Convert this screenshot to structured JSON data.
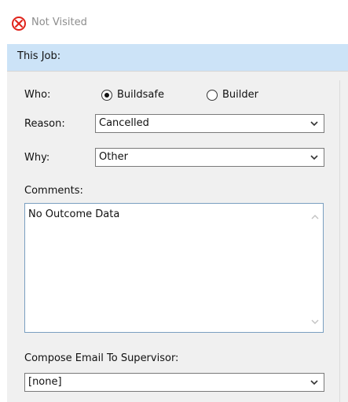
{
  "status": {
    "label": "Not Visited",
    "icon": "circle-x-icon",
    "icon_color": "#e0231a"
  },
  "section": {
    "title": "This Job:"
  },
  "who": {
    "label": "Who:",
    "options": [
      {
        "label": "Buildsafe",
        "selected": true
      },
      {
        "label": "Builder",
        "selected": false
      }
    ]
  },
  "reason": {
    "label": "Reason:",
    "value": "Cancelled"
  },
  "why": {
    "label": "Why:",
    "value": "Other"
  },
  "comments": {
    "label": "Comments:",
    "value": "No Outcome Data"
  },
  "email": {
    "label": "Compose Email To Supervisor:",
    "value": "[none]"
  },
  "colors": {
    "section_bar": "#cce3f7",
    "panel": "#f0f0f0",
    "status_text": "#8d8d8d"
  }
}
